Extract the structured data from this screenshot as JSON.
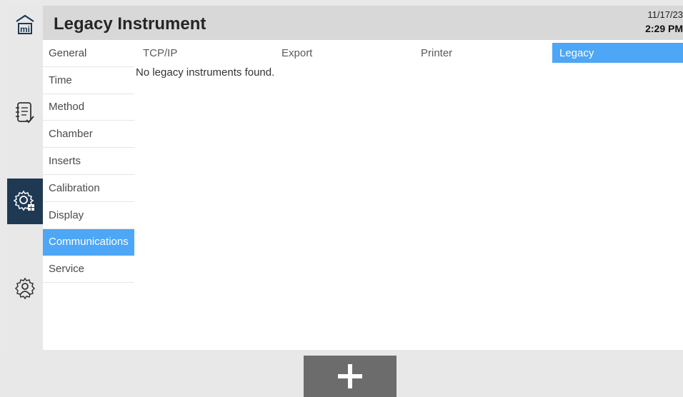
{
  "header": {
    "title": "Legacy Instrument",
    "date": "11/17/23",
    "time": "2:29 PM"
  },
  "rail": {
    "icons": [
      "home-icon",
      "method-checklist-icon",
      "system-settings-icon",
      "user-settings-icon"
    ],
    "active": "system-settings-icon"
  },
  "sidebar": {
    "items": [
      {
        "label": "General"
      },
      {
        "label": "Time"
      },
      {
        "label": "Method"
      },
      {
        "label": "Chamber"
      },
      {
        "label": "Inserts"
      },
      {
        "label": "Calibration"
      },
      {
        "label": "Display"
      },
      {
        "label": "Communications"
      },
      {
        "label": "Service"
      }
    ],
    "active": "Communications"
  },
  "tabs": {
    "items": [
      {
        "label": "TCP/IP"
      },
      {
        "label": "Export"
      },
      {
        "label": "Printer"
      },
      {
        "label": "Legacy"
      }
    ],
    "active": "Legacy"
  },
  "main": {
    "message": "No legacy instruments found."
  },
  "footer": {
    "add_icon": "plus-icon"
  },
  "colors": {
    "accent": "#4ea6f6",
    "rail_active": "#1f3953",
    "add_button": "#6c6c6c"
  }
}
